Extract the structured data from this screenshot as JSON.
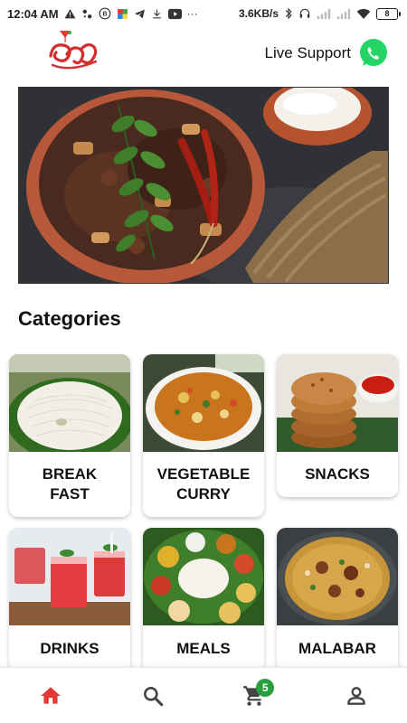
{
  "status_bar": {
    "time": "12:04 AM",
    "network_speed": "3.6KB/s",
    "battery": "8",
    "icons": [
      "warning-icon",
      "settings-icon",
      "b-icon",
      "app-icon",
      "telegram-icon",
      "download-icon",
      "youtube-icon",
      "more-icon",
      "bluetooth-icon",
      "headset-icon",
      "signal-icon",
      "wifi-icon",
      "battery-icon"
    ],
    "more_dots": "···"
  },
  "header": {
    "logo_text": "ജനി",
    "live_support_label": "Live Support",
    "whatsapp_color": "#25D366"
  },
  "banner": {
    "image": "kerala-beef-fry-clay-pot"
  },
  "categories_title": "Categories",
  "categories": [
    {
      "label": "BREAK\nFAST",
      "image": "idiyappam"
    },
    {
      "label": "VEGETABLE\nCURRY",
      "image": "vegetable-curry"
    },
    {
      "label": "SNACKS",
      "image": "cutlets"
    },
    {
      "label": "DRINKS",
      "image": "watermelon-juice"
    },
    {
      "label": "MEALS",
      "image": "meals-thali"
    },
    {
      "label": "MALABAR",
      "image": "biryani"
    }
  ],
  "bottom_nav": {
    "items": [
      "home-icon",
      "search-icon",
      "cart-icon",
      "profile-icon"
    ],
    "cart_count": "5",
    "active_color": "#e53935",
    "inactive_color": "#444444"
  }
}
